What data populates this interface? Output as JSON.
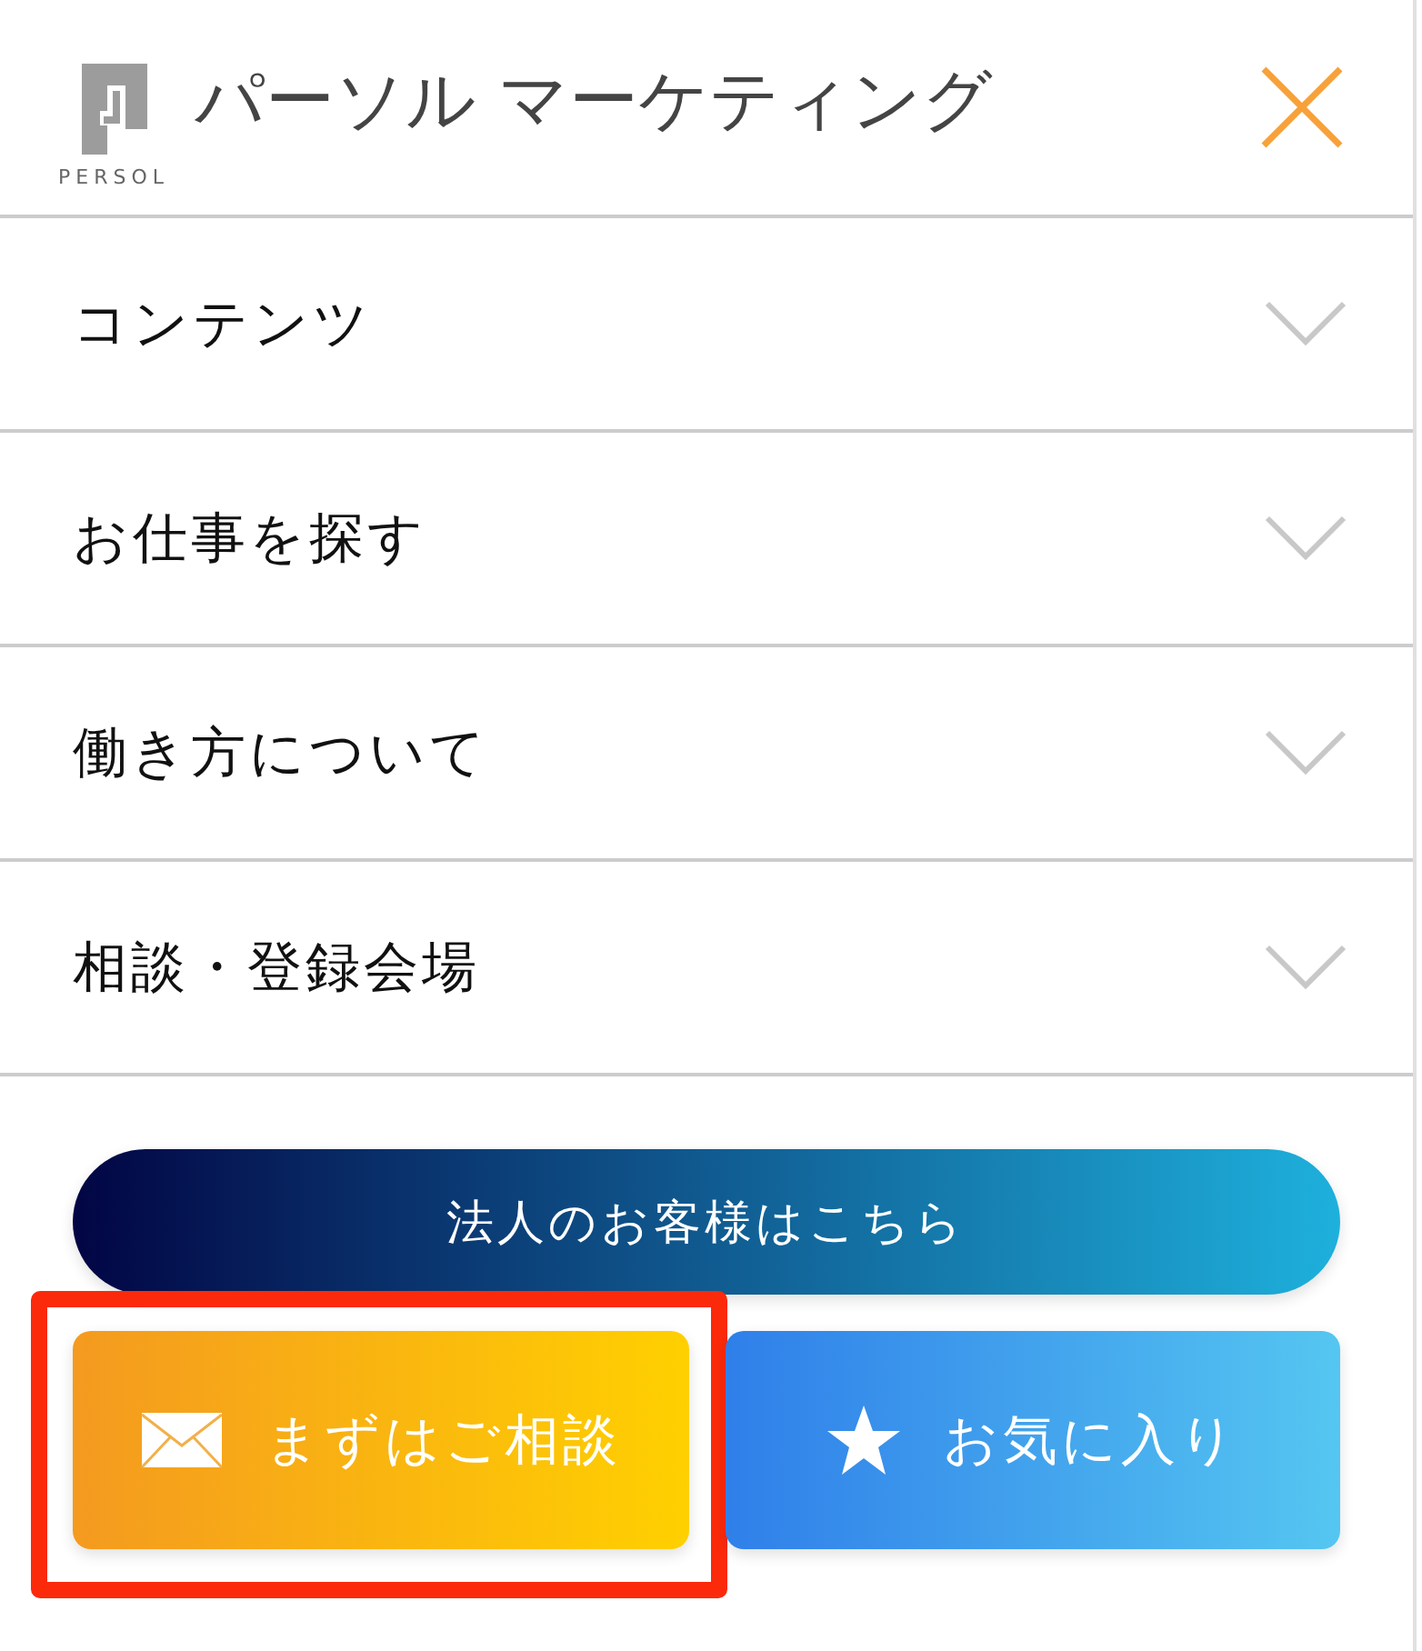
{
  "header": {
    "logo_caption": "PERSOL",
    "brand": "パーソル マーケティング"
  },
  "menu": [
    {
      "label": "コンテンツ",
      "expanded": false
    },
    {
      "label": "お仕事を探す",
      "expanded": false
    },
    {
      "label": "働き方について",
      "expanded": false
    },
    {
      "label": "相談・登録会場",
      "expanded": false
    }
  ],
  "corporate_button": "法人のお客様はこちら",
  "actions": [
    {
      "kind": "mail",
      "label": "まずはご相談",
      "highlighted": true
    },
    {
      "kind": "star",
      "label": "お気に入り",
      "highlighted": false
    }
  ]
}
